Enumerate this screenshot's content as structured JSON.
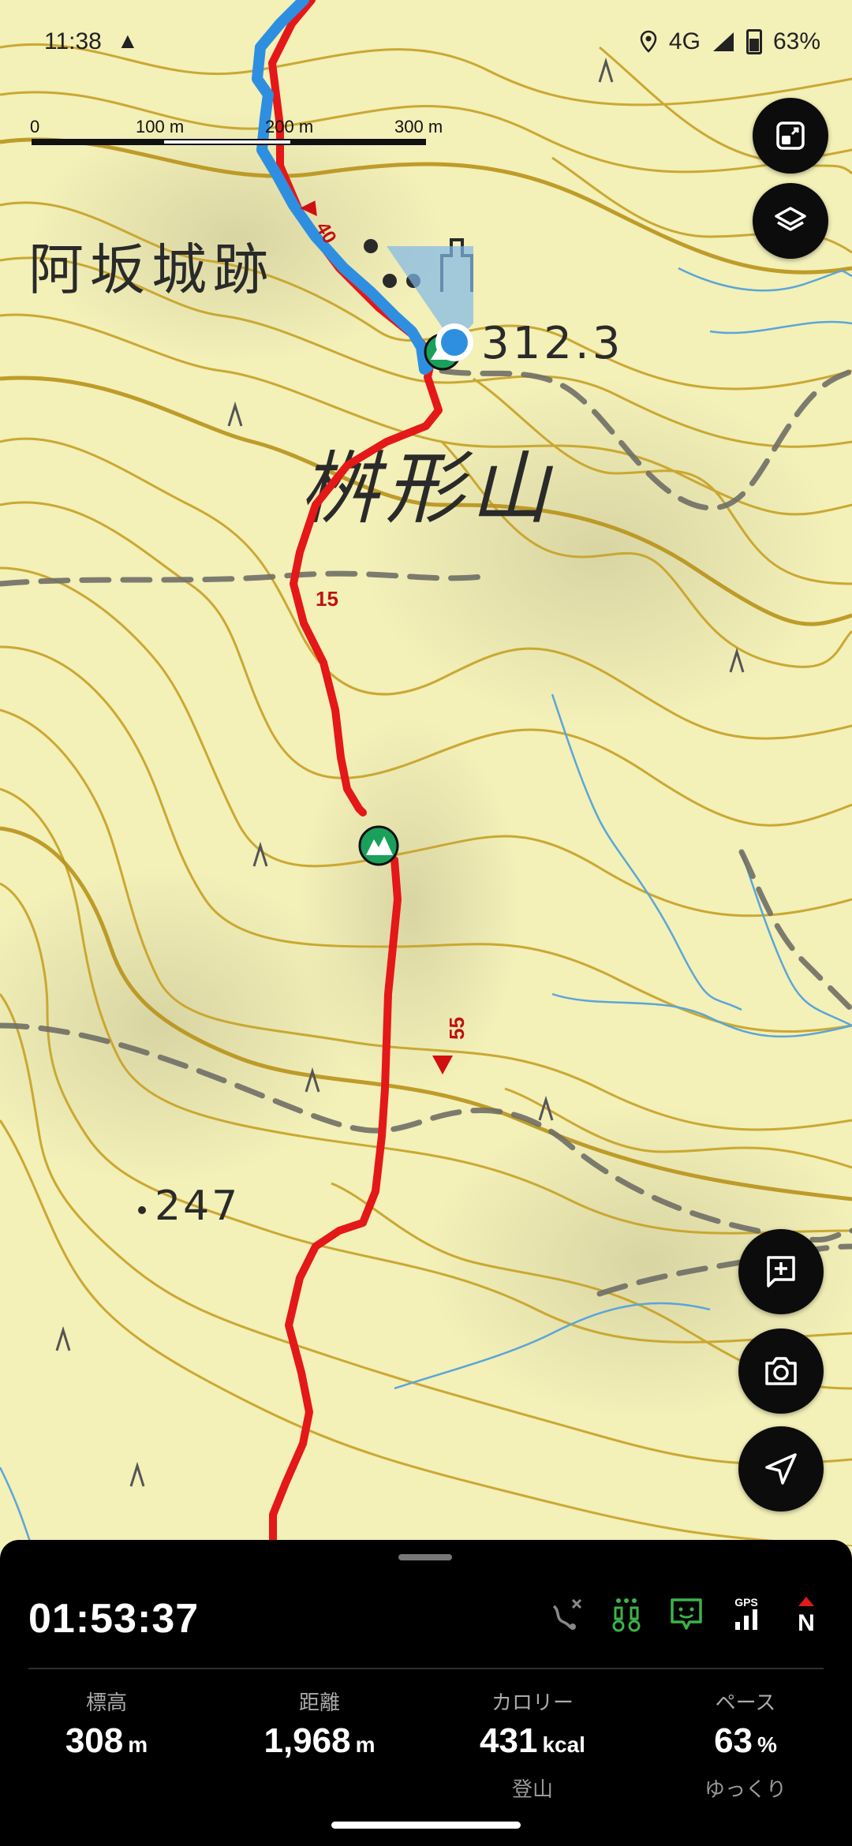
{
  "status_bar": {
    "time": "11:38",
    "network": "4G",
    "battery": "63%"
  },
  "map": {
    "scale_labels": [
      "0",
      "100 m",
      "200 m",
      "300 m"
    ],
    "place_labels": {
      "castle": "阿坂城跡",
      "mountain": "桝形山",
      "summit_elevation": "312.3",
      "spot_height": "247"
    },
    "route_markers": [
      "40",
      "15",
      "55"
    ],
    "colors": {
      "background": "#f3f0b8",
      "contour": "#c9a52c",
      "track": "#e41818",
      "recorded_path": "#2e8fe0",
      "stream": "#5aa6d8",
      "trail_dash": "#6f6e66"
    }
  },
  "controls": {
    "expand_icon": "expand-icon",
    "layers_icon": "layers-icon",
    "add_memo_icon": "add-memo-icon",
    "camera_icon": "camera-icon",
    "navigate_icon": "navigate-icon"
  },
  "panel": {
    "elapsed_time": "01:53:37",
    "gps_label": "GPS",
    "compass_label": "N",
    "stats": [
      {
        "label": "標高",
        "value": "308",
        "unit": "m",
        "sub": ""
      },
      {
        "label": "距離",
        "value": "1,968",
        "unit": "m",
        "sub": ""
      },
      {
        "label": "カロリー",
        "value": "431",
        "unit": "kcal",
        "sub": "登山"
      },
      {
        "label": "ペース",
        "value": "63",
        "unit": "%",
        "sub": "ゆっくり"
      }
    ]
  }
}
